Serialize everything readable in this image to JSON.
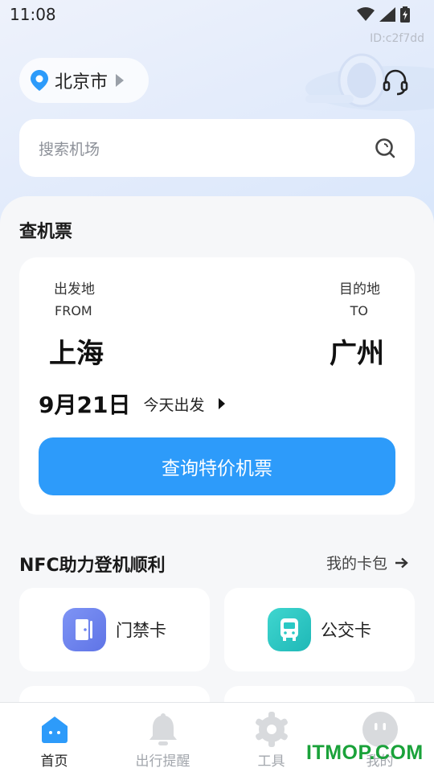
{
  "status_bar": {
    "time": "11:08"
  },
  "device_id": "ID:c2f7dd",
  "header": {
    "city": "北京市"
  },
  "search": {
    "placeholder": "搜索机场"
  },
  "flight_section": {
    "title": "查机票",
    "from_label": "出发地",
    "from_label_en": "FROM",
    "from_city": "上海",
    "to_label": "目的地",
    "to_label_en": "TO",
    "to_city": "广州",
    "date": "9月21日",
    "date_note": "今天出发",
    "search_button": "查询特价机票"
  },
  "nfc_section": {
    "title": "NFC助力登机顺利",
    "wallet_link": "我的卡包",
    "tiles": [
      {
        "label": "门禁卡",
        "icon": "door-card-icon",
        "color": "#6f86f0"
      },
      {
        "label": "公交卡",
        "icon": "bus-icon",
        "color": "#2ac9c4"
      }
    ]
  },
  "tab_bar": {
    "tabs": [
      {
        "label": "首页",
        "icon": "home-icon",
        "active": true
      },
      {
        "label": "出行提醒",
        "icon": "bell-icon",
        "active": false
      },
      {
        "label": "工具",
        "icon": "gear-icon",
        "active": false
      },
      {
        "label": "我的",
        "icon": "profile-icon",
        "active": false
      }
    ]
  },
  "colors": {
    "accent": "#2d9bfa",
    "location_pin": "#2d9bfa",
    "watermark": "#1aa23a"
  },
  "watermark": "ITMOP.COM"
}
